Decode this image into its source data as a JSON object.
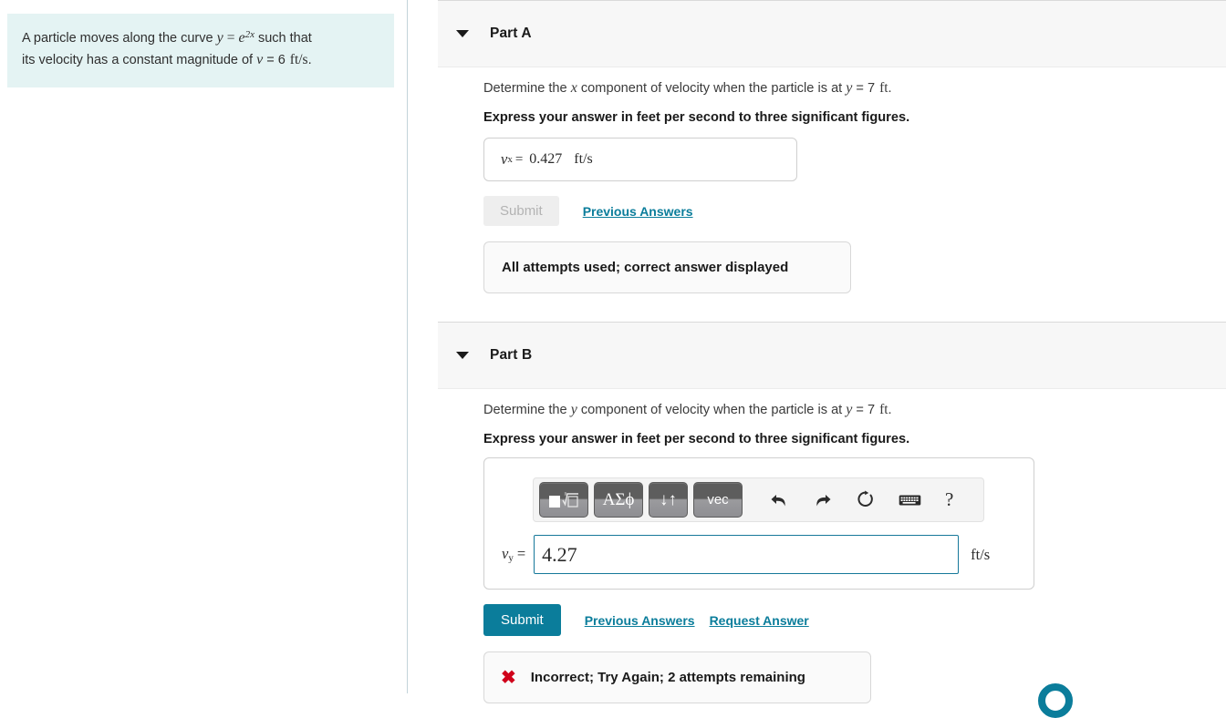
{
  "problem": {
    "text_before_eq": "A particle moves along the curve ",
    "curve_var": "y",
    "equals": "=",
    "curve_base": "e",
    "curve_exponent": "2x",
    "text_mid": " such that",
    "line2_before": "its velocity has a constant magnitude of ",
    "speed_var": "v",
    "speed_eq": "=",
    "speed_value": "6",
    "speed_unit": "ft/s",
    "trailing_period": "."
  },
  "parts": [
    {
      "id": "part-a",
      "caret": "chevron-down-icon",
      "title": "Part A",
      "question_before": "Determine the ",
      "question_var": "x",
      "question_mid": " component of velocity when the particle is at ",
      "condition_var": "y",
      "condition_eq": "=",
      "condition_value": "7",
      "condition_unit": "ft",
      "question_end": ".",
      "instruction": "Express your answer in feet per second to three significant figures.",
      "answer": {
        "label_var": "v",
        "label_sub": "x",
        "equals": "=",
        "value": "0.427",
        "unit": "ft/s"
      },
      "submit_label": "Submit",
      "submit_disabled": true,
      "links": [
        "Previous Answers"
      ],
      "result_message": "All attempts used; correct answer displayed",
      "result_icon": "none"
    },
    {
      "id": "part-b",
      "caret": "chevron-down-icon",
      "title": "Part B",
      "question_before": "Determine the ",
      "question_var": "y",
      "question_mid": " component of velocity when the particle is at ",
      "condition_var": "y",
      "condition_eq": "=",
      "condition_value": "7",
      "condition_unit": "ft",
      "question_end": ".",
      "instruction": "Express your answer in feet per second to three significant figures.",
      "answer": {
        "label_var": "v",
        "label_sub": "y",
        "equals": "=",
        "value": "4.27",
        "unit": "ft/s"
      },
      "submit_label": "Submit",
      "submit_disabled": false,
      "links": [
        "Previous Answers",
        "Request Answer"
      ],
      "result_message": "Incorrect; Try Again; 2 attempts remaining",
      "result_icon": "x-mark-icon",
      "result_icon_glyph": "✖"
    }
  ],
  "math_toolbar": {
    "buttons": [
      {
        "name": "template-radical-button",
        "label": "■√□"
      },
      {
        "name": "greek-letters-button",
        "label": "ΑΣϕ"
      },
      {
        "name": "arrows-button",
        "label": "↓↑"
      },
      {
        "name": "vector-button",
        "label": "vec"
      }
    ],
    "icons": [
      {
        "name": "undo-icon",
        "title": "undo"
      },
      {
        "name": "redo-icon",
        "title": "redo"
      },
      {
        "name": "reset-icon",
        "title": "reset"
      },
      {
        "name": "keyboard-icon",
        "title": "keyboard"
      },
      {
        "name": "help-icon",
        "title": "help",
        "glyph": "?"
      }
    ]
  },
  "colors": {
    "accent_teal": "#0b7d9b",
    "problem_bg": "#e4f3f3",
    "header_bg": "#f7f7f7",
    "error_red": "#d0021b",
    "input_focus_border": "#16789a"
  }
}
